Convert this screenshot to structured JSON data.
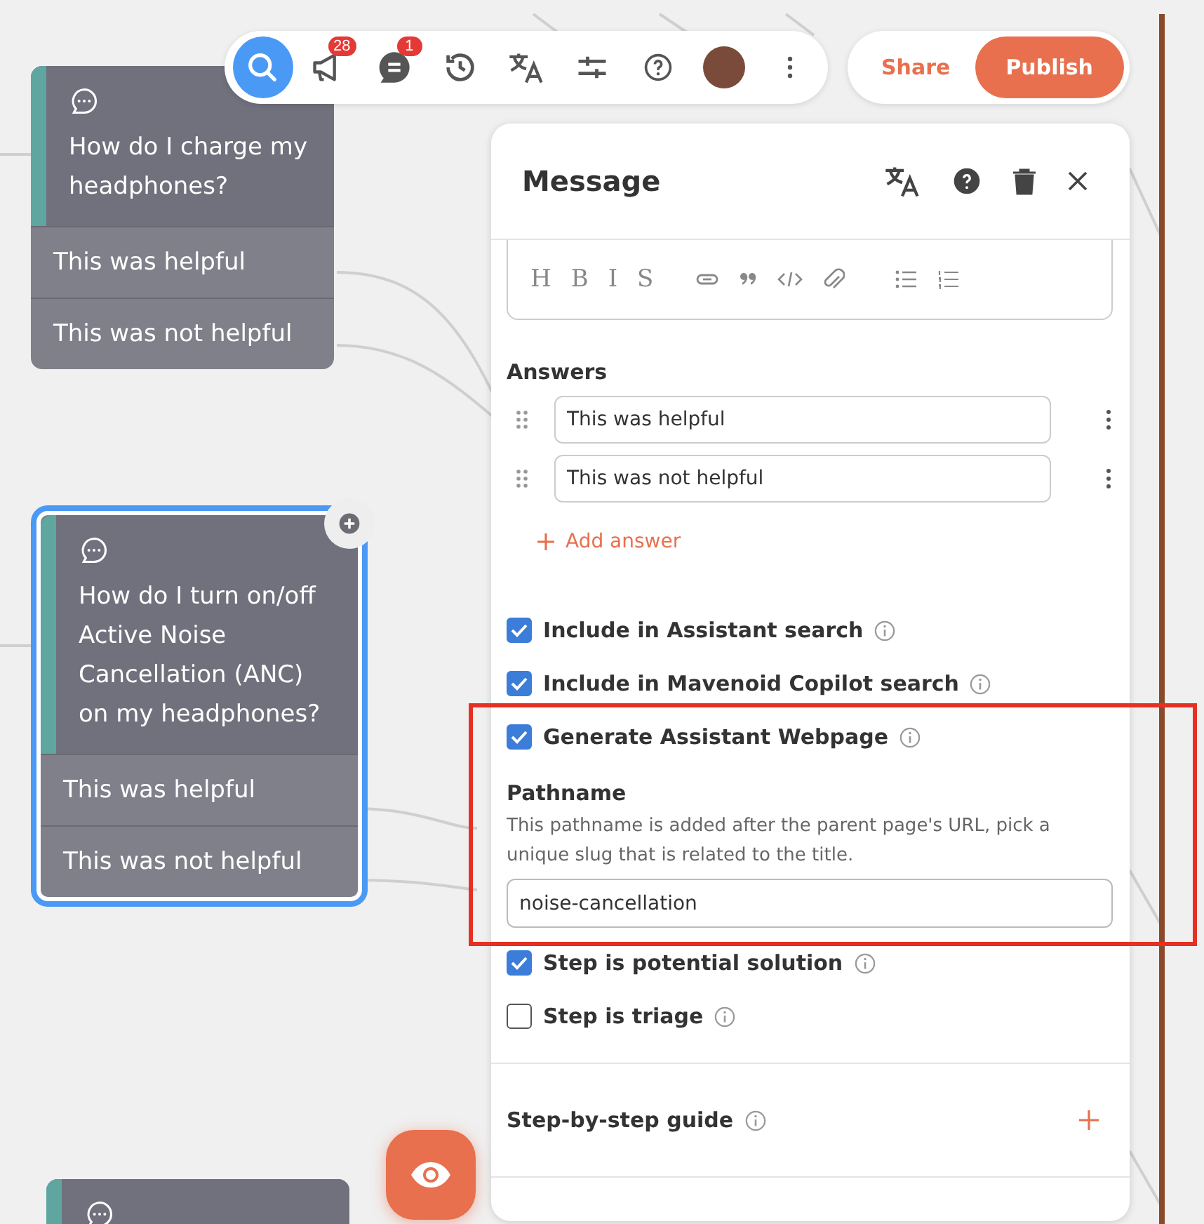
{
  "toolbar": {
    "items": [
      {
        "kind": "search",
        "selected": true
      },
      {
        "kind": "megaphone",
        "badge": "28",
        "selected": false
      },
      {
        "kind": "chat",
        "badge": "1",
        "selected": false
      },
      {
        "kind": "history",
        "selected": false
      },
      {
        "kind": "translate",
        "selected": false
      },
      {
        "kind": "sliders",
        "selected": false
      },
      {
        "kind": "help",
        "selected": false
      },
      {
        "kind": "avatar",
        "selected": false
      },
      {
        "kind": "more",
        "selected": false
      }
    ],
    "share": "Share",
    "publish": "Publish"
  },
  "nodes": [
    {
      "title": "How do I charge my headphones?",
      "selected": false,
      "answers": [
        "This was helpful",
        "This was not helpful"
      ]
    },
    {
      "title": "How do I turn on/off Active Noise Cancellation (ANC) on my headphones?",
      "selected": true,
      "answers": [
        "This was helpful",
        "This was not helpful"
      ]
    },
    {
      "selected": false
    }
  ],
  "panel": {
    "title": "Message",
    "editor_tools": [
      {
        "kind": "letter",
        "text": "H"
      },
      {
        "kind": "letter",
        "text": "B"
      },
      {
        "kind": "letter",
        "text": "I"
      },
      {
        "kind": "letter",
        "text": "S"
      },
      {
        "kind": "link"
      },
      {
        "kind": "quote"
      },
      {
        "kind": "code"
      },
      {
        "kind": "attach"
      },
      {
        "kind": "bullets"
      },
      {
        "kind": "numbers"
      }
    ],
    "answers_label": "Answers",
    "answers": [
      "This was helpful",
      "This was not helpful"
    ],
    "add_answer": "Add answer",
    "options": [
      {
        "kind": "checkbox",
        "label": "Include in Assistant search",
        "checked": true
      },
      {
        "kind": "checkbox",
        "label": "Include in Mavenoid Copilot search",
        "checked": true
      },
      {
        "kind": "checkbox",
        "label": "Generate Assistant Webpage",
        "checked": true
      },
      {
        "kind": "field",
        "label": "Pathname",
        "help": "This pathname is added after the parent page's URL, pick a unique slug that is related to the title.",
        "value": "noise-cancellation"
      },
      {
        "kind": "checkbox",
        "label": "Step is potential solution",
        "checked": true
      },
      {
        "kind": "checkbox",
        "label": "Step is triage",
        "checked": false
      }
    ],
    "guide": "Step-by-step guide"
  }
}
